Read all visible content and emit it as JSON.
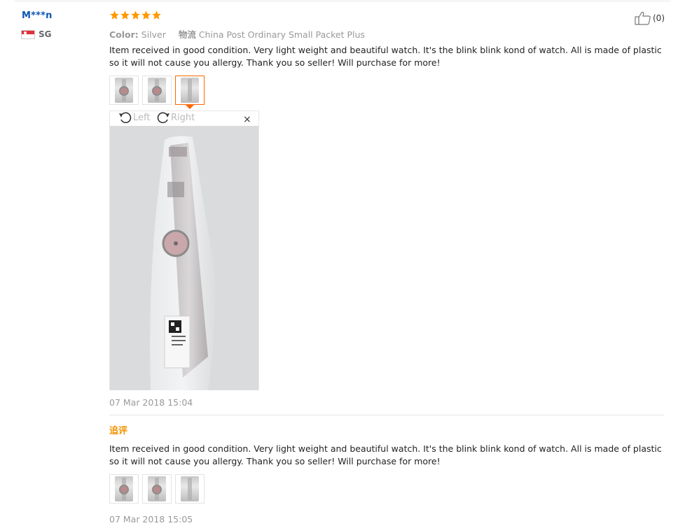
{
  "user": {
    "name": "M***n",
    "country": "SG"
  },
  "rating": {
    "stars": 5,
    "color": "#f90"
  },
  "helpful": {
    "count": "(0)"
  },
  "meta": {
    "color_label": "Color:",
    "color_value": "Silver",
    "shipping_label": "物流",
    "shipping_value": "China Post Ordinary Small Packet Plus"
  },
  "review": {
    "text": "Item received in good condition. Very light weight and beautiful watch. It's the blink blink kond of watch. All is made of plastic so it will not cause you allergy. Thank you so seller! Will purchase for more!",
    "date": "07 Mar 2018 15:04"
  },
  "viewer": {
    "left_label": "Left",
    "right_label": "Right",
    "close_label": "×"
  },
  "followup": {
    "title": "追评",
    "text": "Item received in good condition. Very light weight and beautiful watch. It's the blink blink kond of watch. All is made of plastic so it will not cause you allergy. Thank you so seller! Will purchase for more!",
    "date": "07 Mar 2018 15:05"
  },
  "colors": {
    "accent": "#f60",
    "link": "#0b57b5",
    "followup": "#f29400"
  }
}
